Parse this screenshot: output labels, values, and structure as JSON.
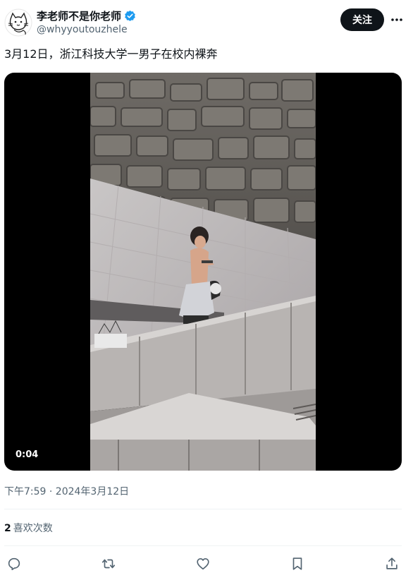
{
  "author": {
    "display_name": "李老师不是你老师",
    "handle": "@whyyoutouzhele",
    "verified": true,
    "avatar_icon": "cat-doodle-avatar-icon"
  },
  "header": {
    "follow_label": "关注",
    "more_icon": "more-horizontal-icon"
  },
  "tweet": {
    "text": "3月12日，浙江科技大学一男子在校内裸奔"
  },
  "media": {
    "type": "video",
    "duration": "0:04"
  },
  "meta": {
    "timestamp": "下午7:59 · 2024年3月12日"
  },
  "stats": {
    "likes_count": "2",
    "likes_label": "喜欢次数"
  },
  "actions": [
    {
      "name": "reply",
      "icon": "reply-bubble-icon"
    },
    {
      "name": "retweet",
      "icon": "retweet-icon"
    },
    {
      "name": "like",
      "icon": "heart-icon"
    },
    {
      "name": "bookmark",
      "icon": "bookmark-icon"
    },
    {
      "name": "share",
      "icon": "share-icon"
    }
  ],
  "colors": {
    "text": "#0f1419",
    "secondary": "#536471",
    "verified_blue": "#1d9bf0",
    "follow_bg": "#0f1419",
    "divider": "#eff3f4"
  }
}
